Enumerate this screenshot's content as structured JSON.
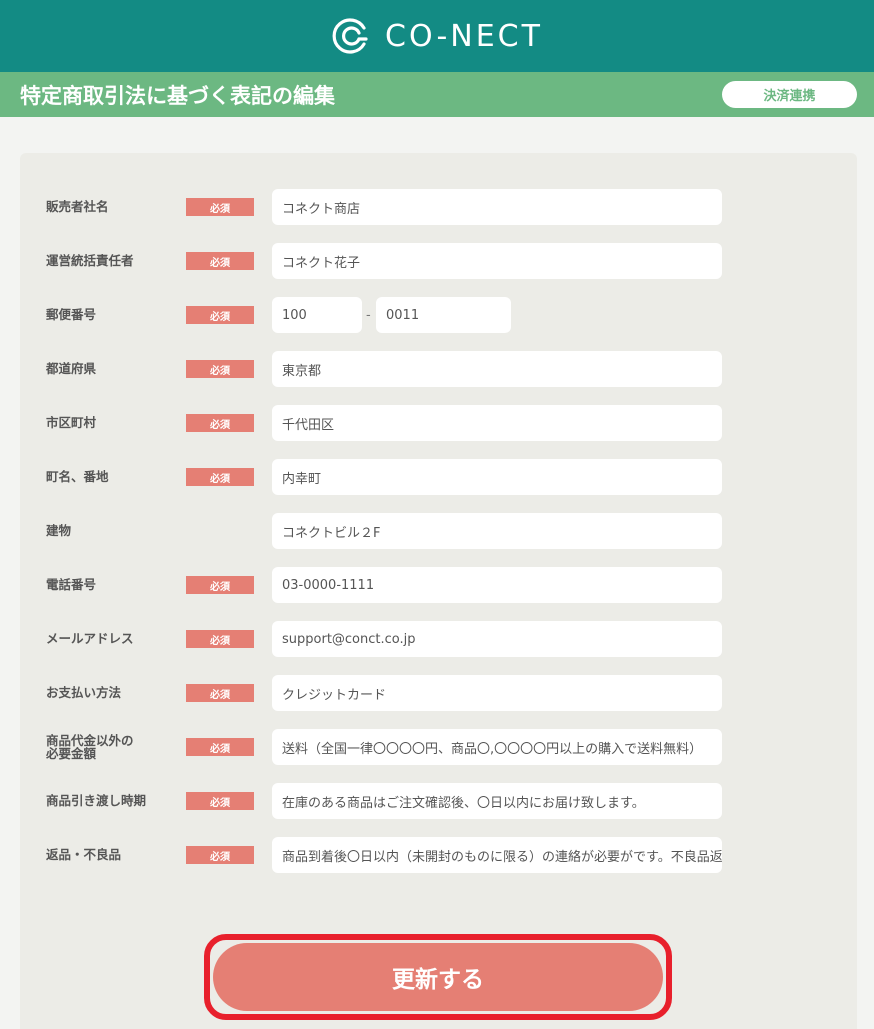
{
  "header": {
    "logo_text": "CO-NECT",
    "logo_icon": "co-nect-logo-icon"
  },
  "titlebar": {
    "title": "特定商取引法に基づく表記の編集",
    "settle_button": "決済連携"
  },
  "required_label": "必須",
  "form": {
    "seller_name": {
      "label": "販売者社名",
      "value": "コネクト商店"
    },
    "manager": {
      "label": "運営統括責任者",
      "value": "コネクト花子"
    },
    "postal_code": {
      "label": "郵便番号",
      "part1": "100",
      "separator": "-",
      "part2": "0011"
    },
    "prefecture": {
      "label": "都道府県",
      "value": "東京都"
    },
    "city": {
      "label": "市区町村",
      "value": "千代田区"
    },
    "town": {
      "label": "町名、番地",
      "value": "内幸町"
    },
    "building": {
      "label": "建物",
      "value": "コネクトビル２F"
    },
    "phone": {
      "label": "電話番号",
      "value": "03-0000-1111"
    },
    "email": {
      "label": "メールアドレス",
      "value": "support@conct.co.jp"
    },
    "payment": {
      "label": "お支払い方法",
      "value": "クレジットカード"
    },
    "extra_fees": {
      "label_line1": "商品代金以外の",
      "label_line2": "必要金額",
      "value": "送料（全国一律〇〇〇〇円、商品〇,〇〇〇〇円以上の購入で送料無料）"
    },
    "delivery": {
      "label": "商品引き渡し時期",
      "value": "在庫のある商品はご注文確認後、〇日以内にお届け致します。"
    },
    "returns": {
      "label": "返品・不良品",
      "value": "商品到着後〇日以内（未開封のものに限る）の連絡が必要がです。不良品返品"
    }
  },
  "submit_button": "更新する",
  "colors": {
    "header_bg": "#138b84",
    "titlebar_bg": "#6cb882",
    "required_bg": "#e57f74",
    "submit_bg": "#e57f74",
    "highlight_border": "#e8202c"
  }
}
